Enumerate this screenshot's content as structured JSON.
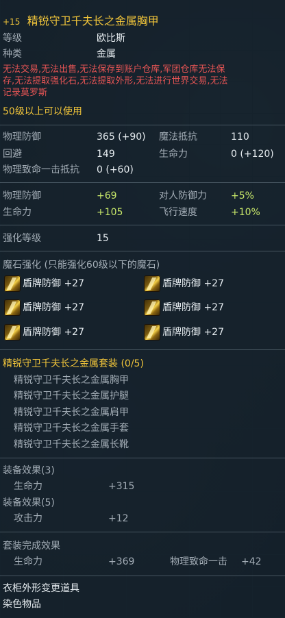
{
  "item": {
    "enchant": "+15",
    "name": "精锐守卫千夫长之金属胸甲"
  },
  "info": [
    {
      "label": "等级",
      "value": "欧比斯"
    },
    {
      "label": "种类",
      "value": "金属"
    }
  ],
  "restrictions": "无法交易,无法出售,无法保存到账户仓库,军团仓库无法保存,无法提取强化石,无法提取外形,无法进行世界交易,无法记录莫罗斯",
  "restriction_lines": [
    "无法交易,无法出售,无法保存到账户仓库,军团仓库无法保",
    "存,无法提取强化石,无法提取外形,无法进行世界交易,无法",
    "记录莫罗斯"
  ],
  "level_req": "50级以上可以使用",
  "base_stats": [
    {
      "l1": "物理防御",
      "v1": "365 (+90)",
      "l2": "魔法抵抗",
      "v2": "110"
    },
    {
      "l1": "回避",
      "v1": "149",
      "l2": "生命力",
      "v2": "0 (+120)"
    },
    {
      "l1": "物理致命一击抵抗",
      "v1": "0 (+60)",
      "l2": "",
      "v2": ""
    }
  ],
  "bonus_stats": [
    {
      "l1": "物理防御",
      "v1": "+69",
      "l2": "对人防御力",
      "v2": "+5%"
    },
    {
      "l1": "生命力",
      "v1": "+105",
      "l2": "飞行速度",
      "v2": "+10%"
    }
  ],
  "enchant_level": {
    "label": "强化等级",
    "value": "15"
  },
  "manastones": {
    "header": "魔石强化 (只能强化60级以下的魔石)",
    "slots": [
      "盾牌防御 +27",
      "盾牌防御 +27",
      "盾牌防御 +27",
      "盾牌防御 +27",
      "盾牌防御 +27",
      "盾牌防御 +27"
    ]
  },
  "set": {
    "title": "精锐守卫千夫长之金属套装 (0/5)",
    "pieces": [
      "精锐守卫千夫长之金属胸甲",
      "精锐守卫千夫长之金属护腿",
      "精锐守卫千夫长之金属肩甲",
      "精锐守卫千夫长之金属手套",
      "精锐守卫千夫长之金属长靴"
    ],
    "effect3": {
      "header": "装备效果(3)",
      "label": "生命力",
      "value": "+315"
    },
    "effect5": {
      "header": "装备效果(5)",
      "label": "攻击力",
      "value": "+12"
    },
    "complete": {
      "header": "套装完成效果",
      "l1": "生命力",
      "v1": "+369",
      "l2": "物理致命一击",
      "v2": "+42"
    }
  },
  "footer": [
    "衣柜外形变更道具",
    "染色物品"
  ],
  "colors": {
    "title": "#f0c43a",
    "restriction": "#e45454",
    "bonus": "#c8e86a"
  },
  "icons": {
    "manastone": "manastone-icon"
  }
}
